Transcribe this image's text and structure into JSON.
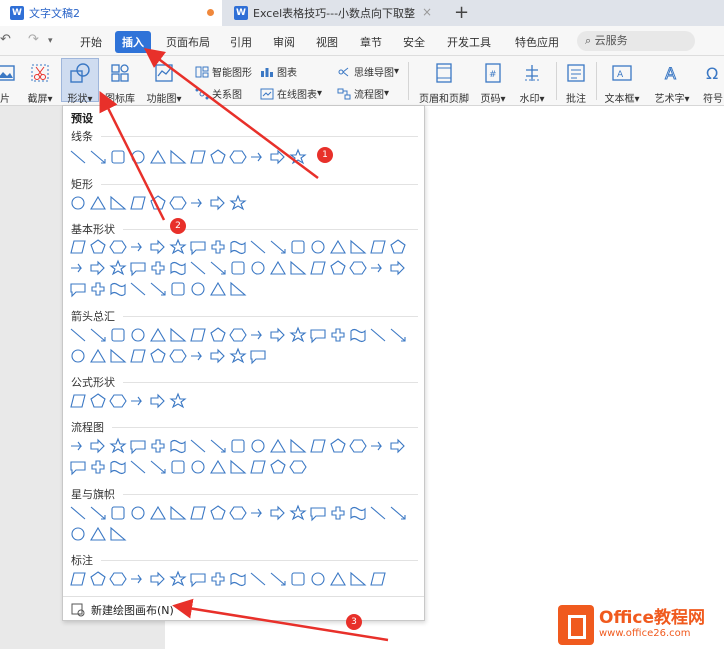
{
  "tabs": [
    {
      "title": "文字文稿2",
      "logo": "W"
    },
    {
      "title": "Excel表格技巧---小数点向下取整",
      "logo": "W"
    }
  ],
  "menu": {
    "items": [
      "开始",
      "插入",
      "页面布局",
      "引用",
      "审阅",
      "视图",
      "章节",
      "安全",
      "开发工具",
      "特色应用"
    ],
    "selected": "插入",
    "search_placeholder": "云服务"
  },
  "ribbon": {
    "left_partial_1": "片",
    "screenshot": "截屏",
    "shape": "形状",
    "gallery": "图标库",
    "function_chart": "功能图",
    "smart_graphic": "智能图形",
    "chart": "图表",
    "relation_chart": "关系图",
    "online_chart": "在线图表",
    "mindmap": "思维导图",
    "flowchart": "流程图",
    "header_footer": "页眉和页脚",
    "page_number": "页码",
    "watermark": "水印",
    "comment": "批注",
    "textbox": "文本框",
    "wordart": "艺术字",
    "symbol": "符号"
  },
  "dropdown": {
    "header": "预设",
    "sections": [
      {
        "label": "线条",
        "rows": [
          12
        ]
      },
      {
        "label": "矩形",
        "rows": [
          9
        ]
      },
      {
        "label": "基本形状",
        "rows": [
          17,
          17,
          9
        ]
      },
      {
        "label": "箭头总汇",
        "rows": [
          17,
          10
        ]
      },
      {
        "label": "公式形状",
        "rows": [
          6
        ]
      },
      {
        "label": "流程图",
        "rows": [
          17,
          12
        ]
      },
      {
        "label": "星与旗帜",
        "rows": [
          17,
          3
        ]
      },
      {
        "label": "标注",
        "rows": [
          16
        ]
      }
    ],
    "footer": "新建绘图画布(N)"
  },
  "annotations": [
    "1",
    "2",
    "3"
  ],
  "logo": {
    "line1": "Office教程网",
    "line2": "www.office26.com"
  },
  "colors": {
    "accent": "#2f73d8",
    "arrow": "#e8302a",
    "shape_stroke": "#3b78c4",
    "logo": "#f05a1e"
  }
}
